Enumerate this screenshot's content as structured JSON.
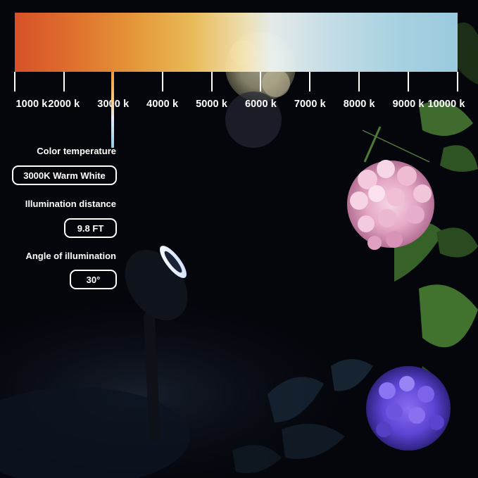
{
  "scale": {
    "ticks": [
      "1000 k",
      "2000 k",
      "3000 k",
      "4000 k",
      "5000 k",
      "6000 k",
      "7000 k",
      "8000 k",
      "9000 k",
      "10000 k"
    ],
    "marker_value_k": 3000
  },
  "specs": [
    {
      "label": "Color temperature",
      "value": "3000K Warm White"
    },
    {
      "label": "Illumination distance",
      "value": "9.8 FT"
    },
    {
      "label": "Angle of illumination",
      "value": "30°"
    }
  ],
  "colors": {
    "warm_end": "#e0542a",
    "cool_end": "#9fd2e6",
    "text": "#ffffff",
    "background": "#04060c"
  },
  "icons": [
    "spotlight-icon",
    "hydrangea-flower",
    "leaf"
  ]
}
